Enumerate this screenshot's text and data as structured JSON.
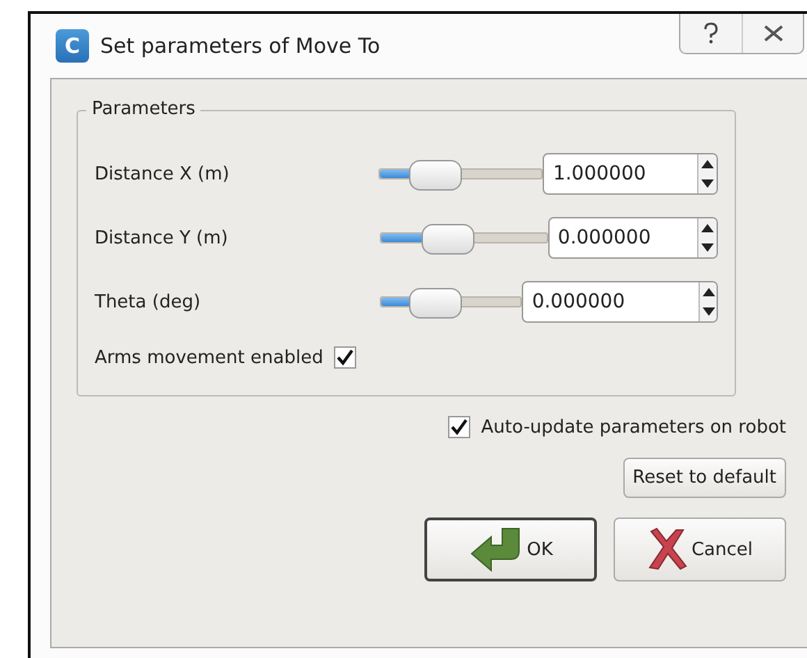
{
  "window": {
    "title": "Set parameters of Move To",
    "app_icon_letter": "C"
  },
  "group": {
    "title": "Parameters"
  },
  "parameters": [
    {
      "label": "Distance X (m)",
      "level": 0.33,
      "value": "1.000000"
    },
    {
      "label": "Distance Y (m)",
      "level": 0.4,
      "value": "0.000000"
    },
    {
      "label": "Theta (deg)",
      "level": 0.38,
      "value": "0.000000"
    }
  ],
  "arms_movement": {
    "label": "Arms movement enabled",
    "checked": true
  },
  "auto_update": {
    "label": "Auto-update parameters on robot",
    "checked": true
  },
  "buttons": [
    {
      "label": "Reset to default",
      "kind": "plain"
    },
    {
      "label": "OK",
      "kind": "ok"
    },
    {
      "label": "Cancel",
      "kind": "cancel"
    }
  ]
}
